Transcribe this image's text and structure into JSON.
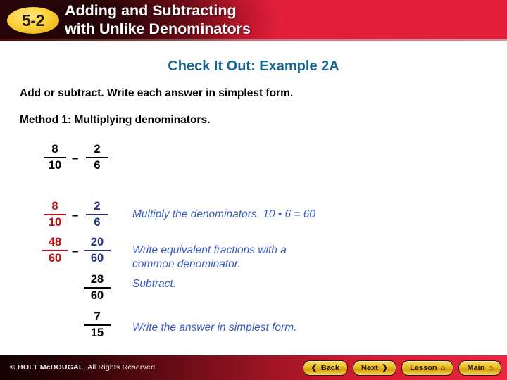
{
  "header": {
    "badge": "5-2",
    "title_line1": "Adding and Subtracting",
    "title_line2": "with Unlike Denominators"
  },
  "slide": {
    "example_title": "Check It Out: Example 2A",
    "instruction_1": "Add or subtract. Write each answer in simplest form.",
    "instruction_2": "Method 1: Multiplying denominators.",
    "problem": {
      "left": {
        "numerator": "8",
        "denominator": "10"
      },
      "operator": "–",
      "right": {
        "numerator": "2",
        "denominator": "6"
      }
    },
    "work_rows": [
      {
        "left": {
          "numerator": "8",
          "denominator": "10",
          "color": "#c20f0f"
        },
        "operator": "–",
        "right": {
          "numerator": "2",
          "denominator": "6",
          "color": "#26307c"
        },
        "note": "Multiply the denominators. 10 • 6 = 60"
      },
      {
        "left": {
          "numerator": "48",
          "denominator": "60",
          "color": "#c20f0f"
        },
        "operator": "–",
        "right": {
          "numerator": "20",
          "denominator": "60",
          "color": "#26307c"
        },
        "note": "Write equivalent fractions with a\ncommon denominator."
      },
      {
        "left": null,
        "operator": "",
        "right": {
          "numerator": "28",
          "denominator": "60",
          "color": "#000000"
        },
        "note": "Subtract."
      },
      {
        "left": null,
        "operator": "",
        "right": {
          "numerator": "7",
          "denominator": "15",
          "color": "#000000"
        },
        "note": "Write the answer in simplest form."
      }
    ],
    "note_1": "Multiply the denominators. 10 • 6 = 60",
    "note_2_line1": "Write equivalent fractions with a",
    "note_2_line2": "common denominator.",
    "note_3": "Subtract.",
    "note_4": "Write the answer in simplest form."
  },
  "footer": {
    "copyright_prefix": "© HOLT McDOUGAL",
    "copyright_suffix": ", All Rights Reserved",
    "buttons": [
      {
        "label": "Back",
        "icon": "chevron-left-icon",
        "glyph": "❮",
        "icon_side": "left"
      },
      {
        "label": "Next",
        "icon": "chevron-right-icon",
        "glyph": "❯",
        "icon_side": "right"
      },
      {
        "label": "Lesson",
        "icon": "home-icon",
        "glyph": "⌂",
        "icon_side": "right"
      },
      {
        "label": "Main",
        "icon": "home-icon",
        "glyph": "⌂",
        "icon_side": "right"
      }
    ]
  },
  "colors": {
    "header_red": "#e3203b",
    "badge_gold": "#ffd23c",
    "title_teal": "#186793",
    "red": "#c20f0f",
    "navy": "#26307c",
    "note_blue": "#3a5bbf"
  }
}
